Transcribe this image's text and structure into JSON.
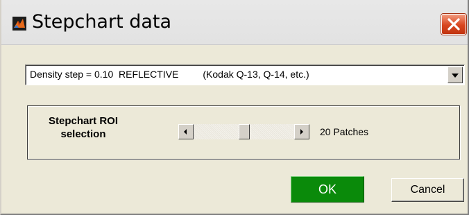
{
  "window": {
    "title": "Stepchart data",
    "icon": "matlab-icon",
    "close_icon": "close-icon"
  },
  "dropdown": {
    "selected": "Density step = 0.10  REFLECTIVE         (Kodak Q-13, Q-14, etc.)",
    "arrow_icon": "chevron-down-icon"
  },
  "roi": {
    "label_line1": "Stepchart ROI",
    "label_line2": "selection",
    "slider_fraction": 0.5,
    "patches_text": "20 Patches"
  },
  "buttons": {
    "ok": "OK",
    "cancel": "Cancel"
  },
  "colors": {
    "ok_button": "#0a8a0a",
    "close_button": "#d8461f",
    "window_bg": "#ece9d8"
  }
}
